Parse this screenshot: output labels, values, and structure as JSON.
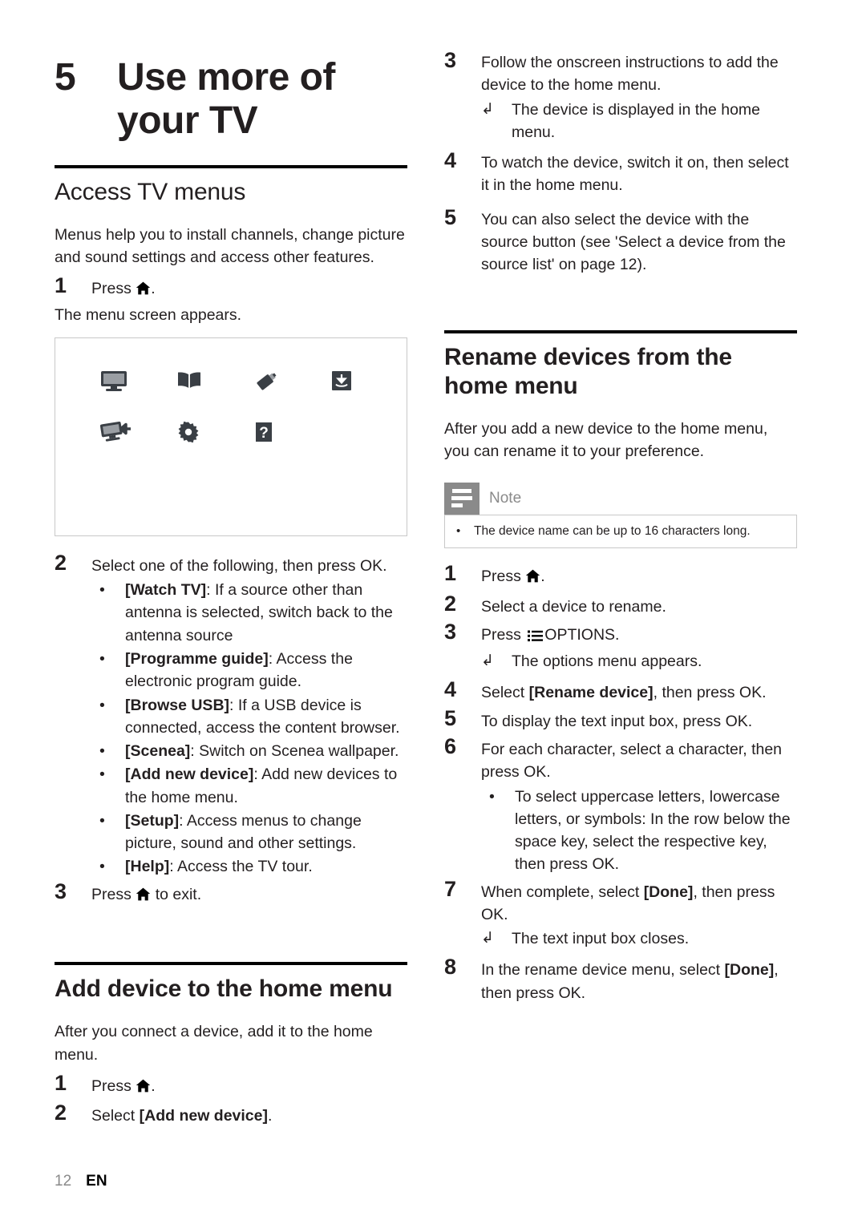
{
  "chapter": {
    "number": "5",
    "title_line1": "Use more of",
    "title_line2": "your TV"
  },
  "sections": {
    "access_tv_menus": {
      "heading": "Access TV menus",
      "intro": "Menus help you to install channels, change picture and sound settings and access other features.",
      "step1_num": "1",
      "step1_text": "Press",
      "step1_tail": ".",
      "step1_result": "The menu screen appears.",
      "figure_icons": [
        "tv-monitor-icon",
        "open-book-icon",
        "usb-stick-icon",
        "scenea-download-icon",
        "tv-add-device-icon",
        "gear-setup-icon",
        "question-help-icon"
      ],
      "step2_num": "2",
      "step2_text": "Select one of the following, then press OK.",
      "bullets": [
        {
          "term": "[Watch TV]",
          "desc": ": If a source other than antenna is selected, switch back to the antenna source"
        },
        {
          "term": "[Programme guide]",
          "desc": ": Access the electronic program guide."
        },
        {
          "term": "[Browse USB]",
          "desc": ": If a USB device is connected, access the content browser."
        },
        {
          "term": "[Scenea]",
          "desc": ": Switch on Scenea wallpaper."
        },
        {
          "term": "[Add new device]",
          "desc": ": Add new devices to the home menu."
        },
        {
          "term": "[Setup]",
          "desc": ": Access menus to change picture, sound and other settings."
        },
        {
          "term": "[Help]",
          "desc": ": Access the TV tour."
        }
      ],
      "step3_num": "3",
      "step3_text_pre": "Press",
      "step3_text_post": "to exit."
    },
    "add_device": {
      "heading": "Add device to the home menu",
      "intro": "After you connect a device, add it to the home menu.",
      "steps": [
        {
          "num": "1",
          "pre": "Press",
          "post": "."
        },
        {
          "num": "2",
          "pre": "Select ",
          "bold": "[Add new device]",
          "post": "."
        }
      ],
      "step3_num": "3",
      "step3_text": "Follow the onscreen instructions to add the device to the home menu.",
      "step3_result": "The device is displayed in the home menu.",
      "step4_num": "4",
      "step4_text": "To watch the device, switch it on, then select it in the home menu.",
      "step5_num": "5",
      "step5_text": "You can also select the device with the source button (see 'Select a device from the source list' on page 12)."
    },
    "rename_devices": {
      "heading_line1": "Rename devices from the",
      "heading_line2": "home menu",
      "intro": "After you add a new device to the home menu, you can rename it to your preference.",
      "note": {
        "title": "Note",
        "items": [
          "The device name can be up to 16 characters long."
        ]
      },
      "steps": [
        {
          "num": "1",
          "pre": "Press",
          "post": "."
        },
        {
          "num": "2",
          "text": "Select a device to rename."
        },
        {
          "num": "3",
          "pre": "Press",
          "post": "OPTIONS.",
          "result": "The options menu appears."
        },
        {
          "num": "4",
          "pre": "Select ",
          "bold": "[Rename device]",
          "post": ", then press OK."
        },
        {
          "num": "5",
          "text": "To display the text input box, press OK."
        },
        {
          "num": "6",
          "text": "For each character, select a character, then press OK.",
          "bullet": "To select uppercase letters, lowercase letters, or symbols: In the row below the space key, select the respective key, then press OK."
        },
        {
          "num": "7",
          "pre": "When complete, select ",
          "bold": "[Done]",
          "post": ", then press OK.",
          "result": "The text input box closes."
        },
        {
          "num": "8",
          "pre": "In the rename device menu, select ",
          "bold": "[Done]",
          "post": ", then press OK."
        }
      ]
    }
  },
  "footer": {
    "page_number": "12",
    "language": "EN"
  },
  "colors": {
    "text": "#231f20",
    "rule": "#000000",
    "note_badge": "#8a8a8a",
    "note_border": "#c8c8c8",
    "figure_border": "#c8c8c8",
    "icon_dark": "#3a3f45"
  }
}
